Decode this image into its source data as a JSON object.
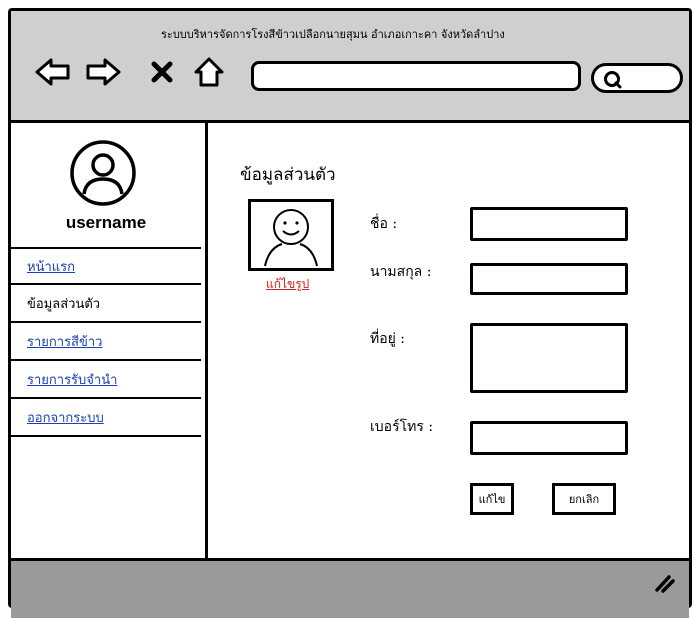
{
  "window": {
    "title": "ระบบบริหารจัดการโรงสีข้าวเปลือกนายสุมน อำเภอเกาะคา จังหวัดลำปาง"
  },
  "toolbar": {
    "back_icon": "back-arrow-icon",
    "forward_icon": "forward-arrow-icon",
    "close_icon": "close-icon",
    "home_icon": "home-icon",
    "url_value": "",
    "search_icon": "search-icon",
    "search_value": ""
  },
  "sidebar": {
    "username": "username",
    "items": [
      {
        "label": "หน้าแรก",
        "state": "link"
      },
      {
        "label": "ข้อมูลส่วนตัว",
        "state": "active"
      },
      {
        "label": "รายการสีข้าว",
        "state": "link"
      },
      {
        "label": "รายการรับจำนำ",
        "state": "link"
      },
      {
        "label": "ออกจากระบบ",
        "state": "link"
      }
    ]
  },
  "profile": {
    "title": "ข้อมูลส่วนตัว",
    "edit_photo": "แก้ไขรูป",
    "fields": {
      "first_name": {
        "label": "ชื่อ :",
        "value": ""
      },
      "last_name": {
        "label": "นามสกุล :",
        "value": ""
      },
      "address": {
        "label": "ที่อยู่ :",
        "value": ""
      },
      "phone": {
        "label": "เบอร์โทร :",
        "value": ""
      }
    },
    "save_label": "แก้ไข",
    "cancel_label": "ยกเลิก"
  },
  "colors": {
    "browser_bar": "#cfcfcf",
    "footer": "#9a9a9a",
    "link": "#1a3fbf",
    "edit_photo": "#d42020"
  }
}
